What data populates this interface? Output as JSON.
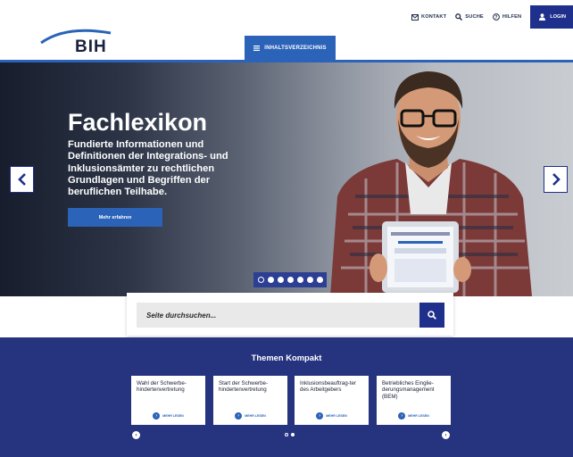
{
  "header": {
    "logo_text": "BIH",
    "topnav": {
      "kontakt": "KONTAKT",
      "suche": "SUCHE",
      "hilfen": "HILFEN",
      "login": "LOGIN"
    },
    "toc_label": "INHALTSVERZEICHNIS"
  },
  "hero": {
    "title": "Fachlexikon",
    "text": "Fundierte Informationen und Definitionen der Integrations- und Inklusionsämter zu rechtlichen Grundlagen und Begriffen der beruflichen Teilhabe.",
    "cta_label": "Mehr erfahren",
    "slide_count": 7,
    "active_slide": 1
  },
  "search": {
    "placeholder": "Seite durchsuchen..."
  },
  "themen": {
    "title": "Themen Kompakt",
    "more_label": "MEHR LESEN",
    "cards": [
      {
        "title": "Wahl der Schwerbe-hindertenvertretung"
      },
      {
        "title": "Start der Schwerbe-hindertenvertretung"
      },
      {
        "title": "Inklusionsbeauftrag-ter des Arbeitgebers"
      },
      {
        "title": "Betriebliches Eingliе-derungsmanagement (BEM)"
      }
    ],
    "page_count": 2,
    "active_page": 1
  },
  "colors": {
    "brand_dark": "#1f2f8c",
    "brand_blue": "#2b63b8",
    "themen_bg": "#26347f"
  }
}
